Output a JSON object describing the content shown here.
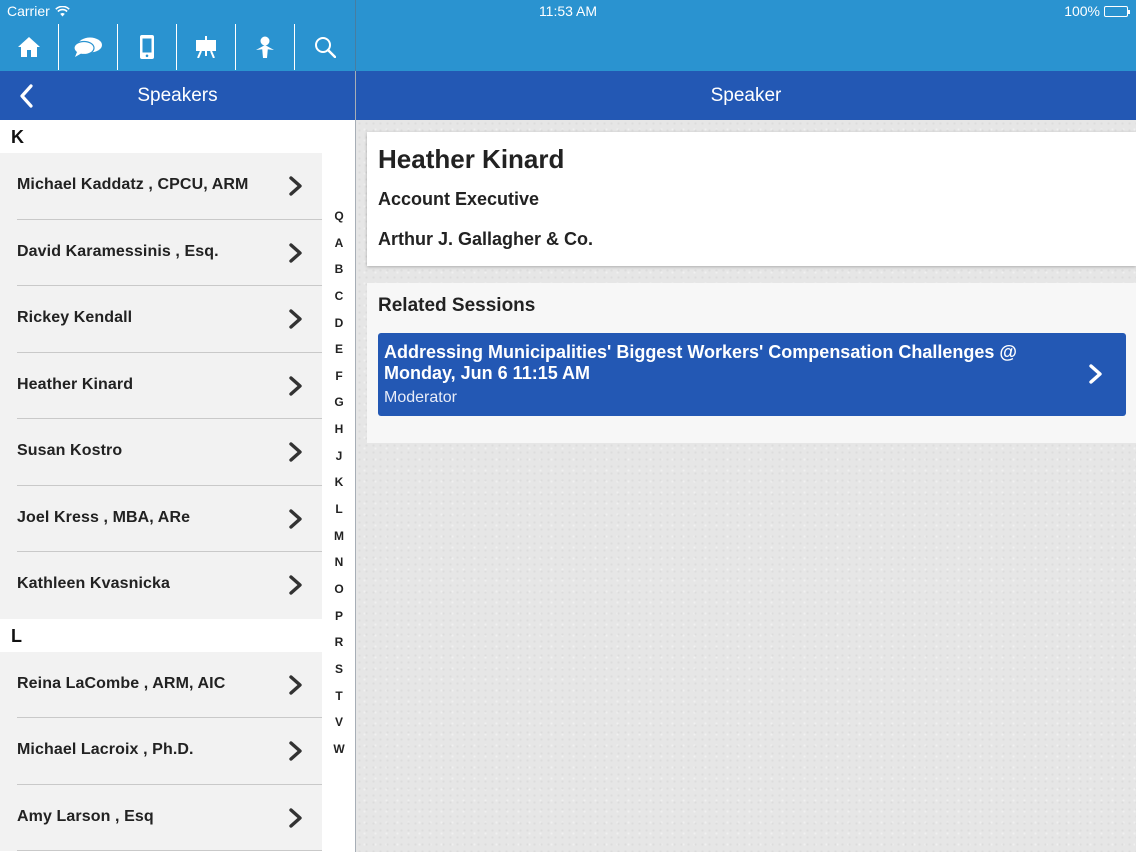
{
  "status_bar": {
    "carrier": "Carrier",
    "time": "11:53 AM",
    "battery": "100%"
  },
  "toolbar": {
    "buttons": [
      "home-icon",
      "chat-bubbles-icon",
      "phone-icon",
      "easel-icon",
      "person-icon",
      "search-icon"
    ]
  },
  "left_nav": {
    "title": "Speakers"
  },
  "right_nav": {
    "title": "Speaker"
  },
  "speakers": {
    "sections": [
      {
        "letter": "K",
        "items": [
          "Michael Kaddatz , CPCU, ARM",
          "David Karamessinis , Esq.",
          "Rickey Kendall",
          "Heather Kinard",
          "Susan Kostro",
          "Joel Kress , MBA, ARe",
          "Kathleen Kvasnicka"
        ]
      },
      {
        "letter": "L",
        "items": [
          "Reina LaCombe , ARM, AIC",
          "Michael Lacroix , Ph.D.",
          "Amy Larson , Esq"
        ]
      }
    ]
  },
  "index_letters": [
    "Q",
    "A",
    "B",
    "C",
    "D",
    "E",
    "F",
    "G",
    "H",
    "J",
    "K",
    "L",
    "M",
    "N",
    "O",
    "P",
    "R",
    "S",
    "T",
    "V",
    "W"
  ],
  "speaker": {
    "name": "Heather Kinard",
    "title": "Account Executive",
    "company": "Arthur J. Gallagher & Co."
  },
  "related": {
    "heading": "Related Sessions",
    "sessions": [
      {
        "title": "Addressing Municipalities' Biggest Workers' Compensation Challenges @ Monday, Jun 6 11:15 AM",
        "role": "Moderator"
      }
    ]
  },
  "colors": {
    "toolbar": "#2a93d0",
    "nav": "#2358b4",
    "session": "#2358b4"
  }
}
